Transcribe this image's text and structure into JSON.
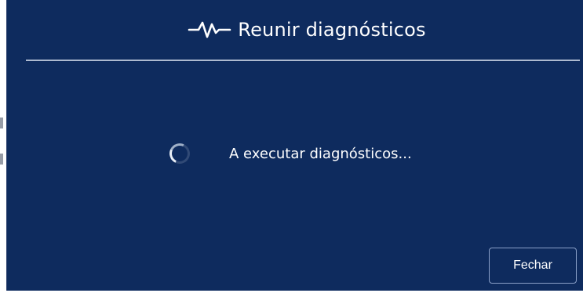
{
  "dialog": {
    "title": "Reunir diagnósticos",
    "title_icon": "pulse-icon",
    "status_text": "A executar diagnósticos...",
    "spinner_icon": "loading-spinner-icon",
    "close_label": "Fechar"
  },
  "colors": {
    "dialog_bg": "#0e2b5e",
    "divider": "#c9d3e3",
    "text": "#ffffff",
    "button_border": "#8aa0c8"
  }
}
